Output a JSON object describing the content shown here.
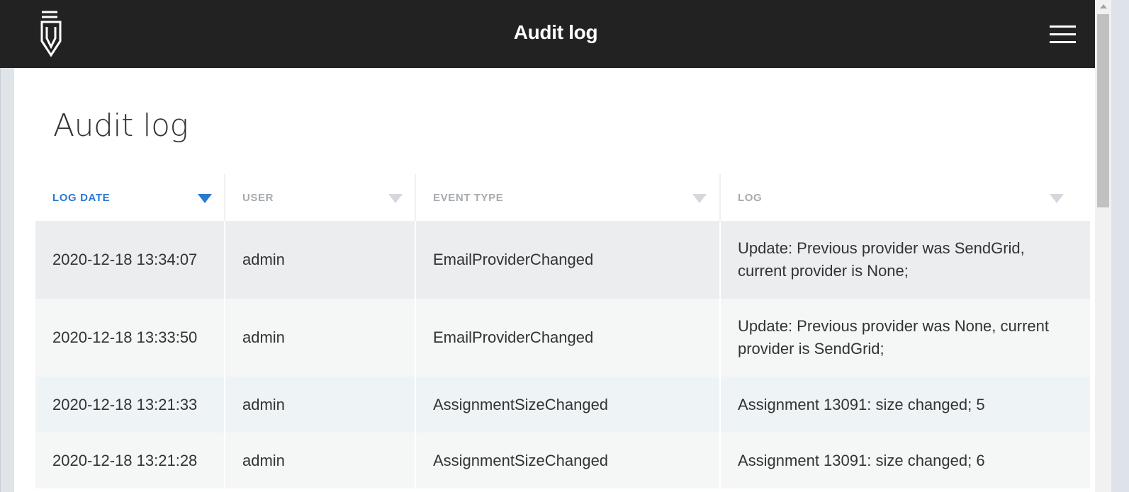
{
  "header": {
    "title": "Audit log",
    "logo_icon": "pen-nib-logo-icon",
    "menu_icon": "hamburger-menu-icon"
  },
  "page": {
    "title": "Audit log"
  },
  "table": {
    "columns": [
      {
        "label": "LOG DATE",
        "sorted": true,
        "sort_direction": "descending"
      },
      {
        "label": "USER",
        "sorted": false
      },
      {
        "label": "EVENT TYPE",
        "sorted": false
      },
      {
        "label": "LOG",
        "sorted": false
      }
    ],
    "rows": [
      {
        "date": "2020-12-18 13:34:07",
        "user": "admin",
        "event_type": "EmailProviderChanged",
        "log": "Update: Previous provider was SendGrid, current provider is None;"
      },
      {
        "date": "2020-12-18 13:33:50",
        "user": "admin",
        "event_type": "EmailProviderChanged",
        "log": "Update: Previous provider was None, current provider is SendGrid;"
      },
      {
        "date": "2020-12-18 13:21:33",
        "user": "admin",
        "event_type": "AssignmentSizeChanged",
        "log": "Assignment 13091: size changed; 5"
      },
      {
        "date": "2020-12-18 13:21:28",
        "user": "admin",
        "event_type": "AssignmentSizeChanged",
        "log": "Assignment 13091: size changed; 6"
      }
    ]
  },
  "colors": {
    "topbar": "#222222",
    "accent": "#2b7ad1",
    "header_inactive": "#a7abaf",
    "text": "#333333"
  }
}
